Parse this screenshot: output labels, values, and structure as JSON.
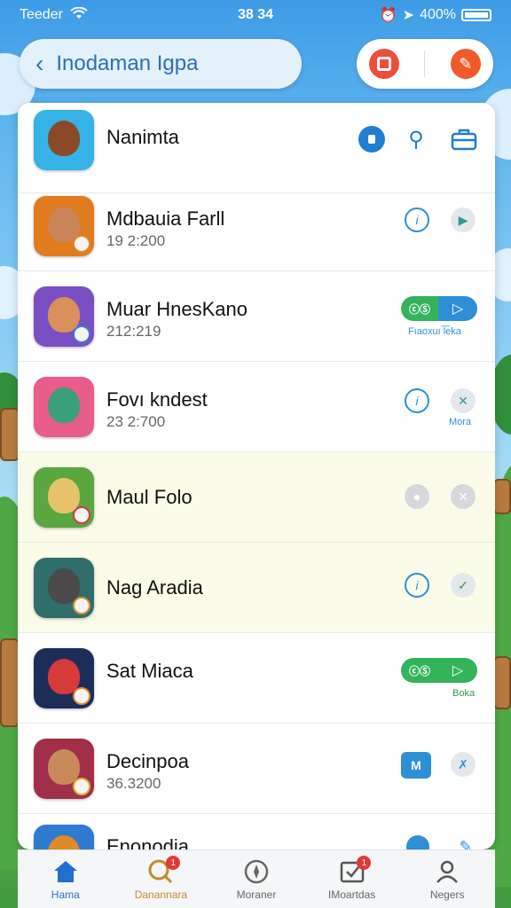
{
  "status_bar": {
    "carrier": "Teeder",
    "time": "38 34",
    "battery": "400%"
  },
  "search_bar": {
    "back_icon": "chevron-left-icon",
    "title": "Inodaman Igpa"
  },
  "header_actions": {
    "stop_icon": "stop-icon",
    "tool_icon": "wrench-icon"
  },
  "apps": [
    {
      "name": "Nanimta",
      "date": ""
    },
    {
      "name": "Mdbauia Farll",
      "date": "19 2:200"
    },
    {
      "name": "Muar HnesKano",
      "date": "212:219",
      "toggle_left": "ⓒⓈ",
      "caption": "Fıaoxuı l͞eka"
    },
    {
      "name": "Fovı kndest",
      "date": "23 2:700",
      "caption": "Mora"
    },
    {
      "name": "Maul Folo",
      "date": ""
    },
    {
      "name": "Nag Aradia",
      "date": ""
    },
    {
      "name": "Sat Miaca",
      "date": "",
      "toggle_left": "ⓒⓈ",
      "caption": "Boka"
    },
    {
      "name": "Decinpoa",
      "date": "36.3200",
      "square_label": "M"
    },
    {
      "name": "Enonodia",
      "date": ""
    }
  ],
  "tabs": [
    {
      "label": "Hama",
      "icon": "home-icon",
      "badge": ""
    },
    {
      "label": "Danannara",
      "icon": "search-icon",
      "badge": "1"
    },
    {
      "label": "Moraner",
      "icon": "compass-icon",
      "badge": ""
    },
    {
      "label": "IMoartdas",
      "icon": "check-inbox-icon",
      "badge": "1"
    },
    {
      "label": "Negers",
      "icon": "person-icon",
      "badge": ""
    }
  ]
}
